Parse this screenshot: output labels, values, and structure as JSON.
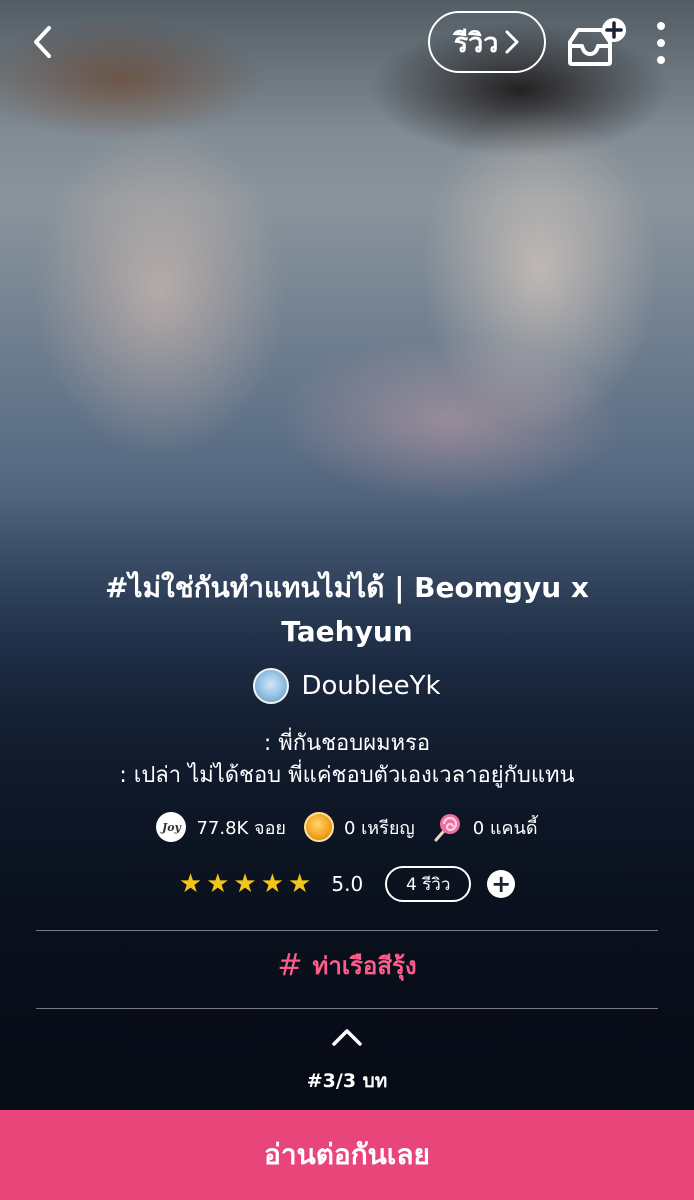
{
  "header": {
    "review_label": "รีวิว"
  },
  "story": {
    "title": "#ไม่ใช่กันทำแทนไม่ได้ | Beomgyu x Taehyun",
    "author": "DoubleeYk",
    "synopsis_line1": ": พี่กันชอบผมหรอ",
    "synopsis_line2": ": เปล่า ไม่ได้ชอบ พี่แค่ชอบตัวเองเวลาอยู่กับแทน"
  },
  "stats": {
    "joy_icon_text": "Joy",
    "joy": "77.8K จอย",
    "coins": "0 เหรียญ",
    "candy": "0 แคนดี้"
  },
  "rating": {
    "stars": "★★★★★",
    "value": "5.0",
    "review_count": "4 รีวิว",
    "add_symbol": "+"
  },
  "tag": {
    "hash": "#",
    "label": "ท่าเรือสีรุ้ง"
  },
  "chapter": {
    "label": "#3/3 บท"
  },
  "cta": {
    "label": "อ่านต่อกันเลย"
  },
  "colors": {
    "accent": "#e8467a",
    "tag": "#ff5c8a",
    "star": "#f3c419"
  }
}
